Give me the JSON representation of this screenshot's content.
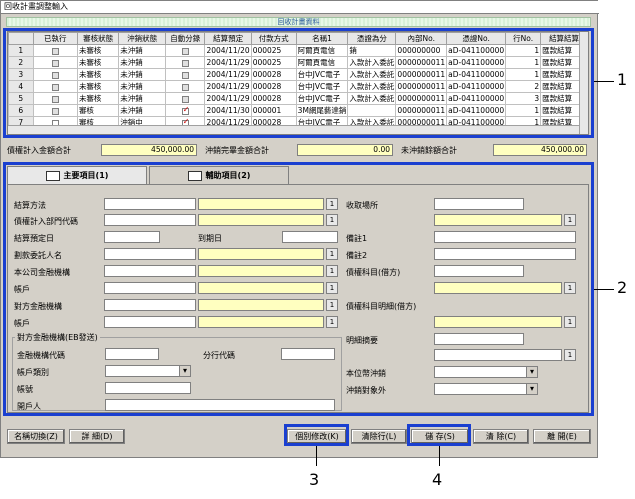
{
  "window": {
    "title": "回收計畫調整輸入",
    "banner": "回收計畫資料"
  },
  "grid": {
    "headers": [
      "",
      "已執行",
      "審核狀態",
      "沖銷狀態",
      "自動分錄",
      "結算預定",
      "付款方式",
      "名稱1",
      "憑證為分",
      "內部No.",
      "憑證No.",
      "行No.",
      "結算結算"
    ],
    "rows": [
      [
        "1",
        "off",
        "未審核",
        "未沖銷",
        "off",
        "2004/11/20",
        "000025",
        "阿爾頁電信",
        "銷",
        "000000000",
        "aD-041100000",
        "1",
        "匯款結算"
      ],
      [
        "2",
        "off",
        "未審核",
        "未沖銷",
        "off",
        "2004/11/29",
        "000025",
        "阿爾頁電信",
        "入款計入委託",
        "0000000011",
        "aD-041100000",
        "1",
        "匯款結算"
      ],
      [
        "3",
        "off",
        "未審核",
        "未沖銷",
        "off",
        "2004/11/29",
        "000028",
        "台中JVC電子",
        "入款計入委託",
        "0000000011",
        "aD-041100000",
        "1",
        "匯款結算"
      ],
      [
        "4",
        "off",
        "未審核",
        "未沖銷",
        "off",
        "2004/11/29",
        "000028",
        "台中JVC電子",
        "入款計入委託",
        "0000000011",
        "aD-041100000",
        "2",
        "匯款結算"
      ],
      [
        "5",
        "off",
        "未審核",
        "未沖銷",
        "off",
        "2004/11/29",
        "000028",
        "台中JVC電子",
        "入款計入委託",
        "0000000011",
        "aD-041100000",
        "3",
        "匯款結算"
      ],
      [
        "6",
        "off",
        "審核",
        "未沖銷",
        "red",
        "2004/11/30",
        "000001",
        "3M網尾藝達銷",
        "",
        "0000000011",
        "aD-041100000",
        "1",
        "匯款結算"
      ],
      [
        "7",
        "on",
        "審核",
        "沖銷中",
        "red",
        "2004/11/29",
        "000028",
        "台中JVC電子",
        "入款計入委託",
        "0000000011",
        "aD-041100000",
        "1",
        "匯款結算"
      ]
    ]
  },
  "totals": {
    "l1": "債權計入金額合計",
    "v1": "450,000.00",
    "l2": "沖銷完畢金額合計",
    "v2": "0.00",
    "l3": "未沖銷餘額合計",
    "v3": "450,000.00"
  },
  "tabs": {
    "main": "主要項目(1)",
    "aux": "輔助項目(2)"
  },
  "form": {
    "settle_method": "結算方法",
    "dept_code": "債權計入部門代碼",
    "settle_date": "結算預定日",
    "due_date": "到期日",
    "consignor": "劃款委託人名",
    "company_bank": "本公司金融機構",
    "account": "帳戶",
    "counter_bank": "對方金融機構",
    "account2": "帳戶",
    "group_title": "對方金融機構(EB發送)",
    "bank_code": "金融機構代碼",
    "branch_code": "分行代碼",
    "acct_type": "帳戶類別",
    "acct_no": "帳號",
    "holder": "開戶人",
    "receipt_place": "收取場所",
    "note1": "備註1",
    "note2": "備註2",
    "debit_subject": "債權科目(借方)",
    "debit_detail": "債權科目明細(借方)",
    "detail_summary": "明細摘要",
    "currency_off": "本位幣沖銷",
    "offset_target": "沖銷對象外",
    "one": "1"
  },
  "buttons": {
    "rename": "名稱切換(Z)",
    "detail": "詳 細(D)",
    "individual": "個別修改(K)",
    "clear_row": "清除行(L)",
    "save": "儲 存(S)",
    "clear": "清 除(C)",
    "close": "離 開(E)"
  },
  "callouts": {
    "c1": "1",
    "c2": "2",
    "c3": "3",
    "c4": "4"
  }
}
